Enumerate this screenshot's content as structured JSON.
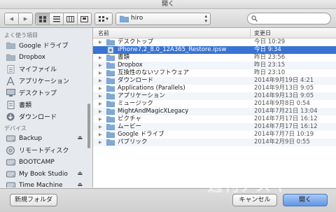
{
  "window": {
    "title": "開く"
  },
  "toolbar": {
    "back_glyph": "◀",
    "forward_glyph": "▶",
    "view_modes": [
      "icon-view",
      "list-view",
      "column-view",
      "coverflow-view"
    ],
    "arrange_glyph": "▾",
    "path_popup": {
      "label": "hiro",
      "arrow": "⌃⌄"
    }
  },
  "sidebar": {
    "favorites_header": "よく使う項目",
    "favorites": [
      {
        "label": "Google ドライブ",
        "icon": "folder-icon"
      },
      {
        "label": "Dropbox",
        "icon": "folder-icon"
      },
      {
        "label": "マイファイル",
        "icon": "document-icon"
      },
      {
        "label": "アプリケーション",
        "icon": "applications-icon"
      },
      {
        "label": "デスクトップ",
        "icon": "desktop-icon"
      },
      {
        "label": "書類",
        "icon": "documents-icon"
      },
      {
        "label": "ダウンロード",
        "icon": "download-icon"
      }
    ],
    "devices_header": "デバイス",
    "devices": [
      {
        "label": "Backup",
        "icon": "drive-icon",
        "eject": "⏏"
      },
      {
        "label": "リモートディスク",
        "icon": "remote-disc-icon",
        "eject": ""
      },
      {
        "label": "BOOTCAMP",
        "icon": "drive-icon",
        "eject": ""
      },
      {
        "label": "My Book Studio",
        "icon": "drive-icon",
        "eject": "⏏"
      },
      {
        "label": "Time Machine",
        "icon": "drive-icon",
        "eject": "⏏"
      }
    ]
  },
  "file_list": {
    "col_name": "名前",
    "col_date": "変更日",
    "rows": [
      {
        "name": "デスクトップ",
        "date": "今日 10:29",
        "type": "folder",
        "selected": false
      },
      {
        "name": "iPhone7,2_8.0_12A365_Restore.ipsw",
        "date": "今日 9:34",
        "type": "ipsw",
        "selected": true
      },
      {
        "name": "書類",
        "date": "昨日 23:56",
        "type": "folder",
        "selected": false
      },
      {
        "name": "Dropbox",
        "date": "昨日 23:15",
        "type": "folder",
        "selected": false
      },
      {
        "name": "互換性のないソフトウェア",
        "date": "昨日 23:10",
        "type": "folder",
        "selected": false
      },
      {
        "name": "ダウンロード",
        "date": "2014年9月19日 4:21",
        "type": "folder",
        "selected": false
      },
      {
        "name": "Applications (Parallels)",
        "date": "2014年9月13日 9:05",
        "type": "folder",
        "selected": false
      },
      {
        "name": "アプリケーション",
        "date": "2014年9月13日 9:05",
        "type": "folder",
        "selected": false
      },
      {
        "name": "ミュージック",
        "date": "2014年9月8日 0:54",
        "type": "folder",
        "selected": false
      },
      {
        "name": "MightAndMagicXLegacy",
        "date": "2014年7月21日 13:04",
        "type": "folder",
        "selected": false
      },
      {
        "name": "ピクチャ",
        "date": "2014年7月17日 16:12",
        "type": "folder",
        "selected": false
      },
      {
        "name": "ムービー",
        "date": "2014年7月17日 16:12",
        "type": "folder",
        "selected": false
      },
      {
        "name": "Google ドライブ",
        "date": "2014年7月7日 10:19",
        "type": "folder",
        "selected": false
      },
      {
        "name": "パブリック",
        "date": "2014年2月9日 0:55",
        "type": "folder",
        "selected": false
      }
    ]
  },
  "bottom": {
    "new_folder": "新規フォルダ",
    "cancel": "キャンセル",
    "open": "開く"
  },
  "watermark": "週刊アスキー",
  "colors": {
    "selection": "#3873d4",
    "folder": "#7ea9d8",
    "primary_button": "#5f97e6"
  }
}
